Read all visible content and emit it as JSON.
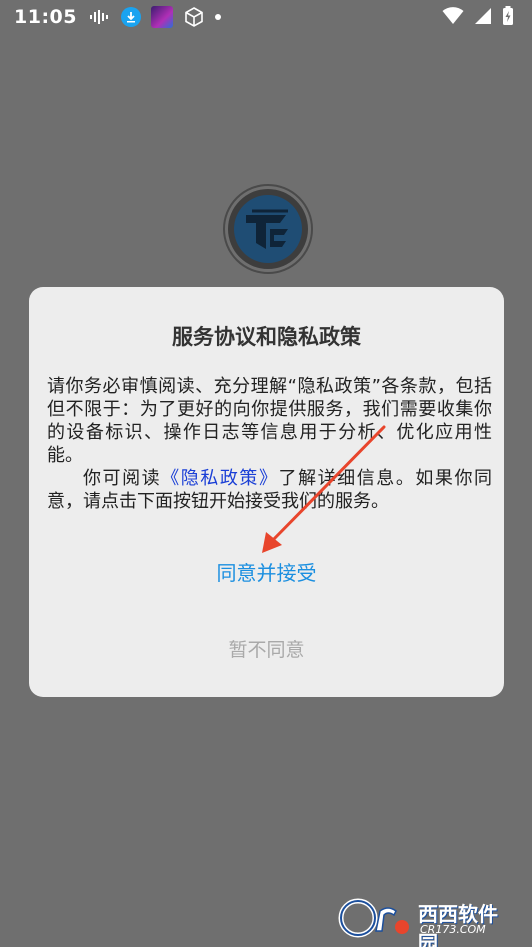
{
  "status_bar": {
    "time": "11:05"
  },
  "dialog": {
    "title": "服务协议和隐私政策",
    "body_p1": "请你务必审慎阅读、充分理解“隐私政策”各条款，包括但不限于：为了更好的向你提供服务，我们需要收集你的设备标识、操作日志等信息用于分析、优化应用性能。",
    "body_p2_prefix": "你可阅读",
    "policy_link": "《隐私政策》",
    "body_p2_suffix": "了解详细信息。如果你同意，请点击下面按钮开始接受我们的服务。",
    "agree_label": "同意并接受",
    "decline_label": "暂不同意"
  },
  "watermark": {
    "text": "西西软件园",
    "sub": "CR173.COM"
  },
  "colors": {
    "overlay_bg": "#6f6f6f",
    "dialog_bg": "#ededed",
    "agree": "#1b8fe0",
    "link": "#1a3fd6",
    "decline": "#a9a9a9",
    "arrow": "#e8452c"
  }
}
